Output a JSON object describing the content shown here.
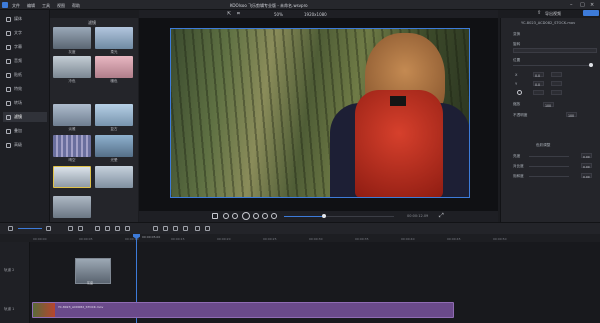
{
  "titlebar": {
    "menu": [
      "文件",
      "编辑",
      "工具",
      "视图",
      "帮助"
    ],
    "title": "KOOlsoo 飞乐剪辑专业版 - 未命名.wsvpro"
  },
  "toolbar_top": {
    "zoom": "50%",
    "resolution": "1920x1080"
  },
  "leftnav": {
    "items": [
      {
        "label": "媒体"
      },
      {
        "label": "文字"
      },
      {
        "label": "字幕"
      },
      {
        "label": "音频"
      },
      {
        "label": "贴纸"
      },
      {
        "label": "特效"
      },
      {
        "label": "转场"
      },
      {
        "label": "滤镜"
      },
      {
        "label": "叠加"
      },
      {
        "label": "高级"
      }
    ]
  },
  "filters": {
    "header": "滤镜",
    "items": [
      {
        "label": "灰度"
      },
      {
        "label": "柔光"
      },
      {
        "label": "冷色"
      },
      {
        "label": "暖色"
      },
      {
        "label": "淡雅"
      },
      {
        "label": "复古"
      },
      {
        "label": "晴空"
      },
      {
        "label": "光晕"
      }
    ]
  },
  "preview": {
    "timecode": "00:00:12.09"
  },
  "props": {
    "filename": "YC-8023_ACD082_STOCK.mov",
    "section1": "变换",
    "rotate_label": "旋转",
    "position_label": "位置",
    "x_label": "X",
    "x_val": "0.0",
    "y_label": "Y",
    "y_val": "0.0",
    "scale_label": "缩放",
    "scale_val": "100",
    "opacity_label": "不透明度",
    "opacity_val": "100",
    "section2": "色彩调整",
    "brightness": "亮度",
    "contrast": "对比度",
    "saturation": "饱和度",
    "brightness_val": "0.00",
    "contrast_val": "0.00",
    "saturation_val": "0.00",
    "export_label": "导出视频"
  },
  "timeline": {
    "timecode": "00:00:05.00",
    "ruler": [
      "00:00:00",
      "00:00:05",
      "00:00:10",
      "00:00:15",
      "00:00:20",
      "00:00:25",
      "00:00:30",
      "00:00:35",
      "00:00:40",
      "00:00:45",
      "00:00:50"
    ],
    "track1_label": "轨道 1",
    "track2_label": "轨道 2",
    "clip_label": "YC-8023_ACD082_STOCK.mov",
    "overlay_label": "灰度"
  },
  "colors": {
    "accent": "#3d7bd9",
    "clip": "#6a4a8a",
    "bg": "#1b1c20"
  }
}
